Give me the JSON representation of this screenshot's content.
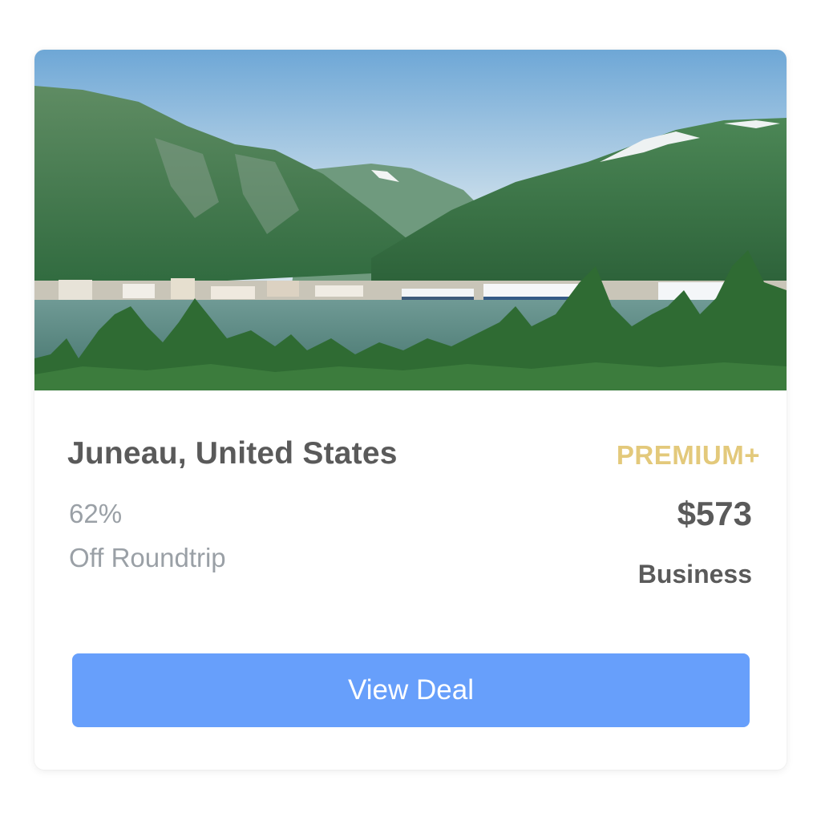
{
  "card": {
    "image_alt": "Juneau harbor with mountains, cruise ships and evergreen trees",
    "destination": "Juneau, United States",
    "tier": "PREMIUM+",
    "discount_percent": "62%",
    "discount_label": "Off Roundtrip",
    "price": "$573",
    "cabin_class": "Business",
    "cta_label": "View Deal"
  },
  "colors": {
    "tier": "#e3c97b",
    "button": "#679ffb",
    "title_text": "#5a5a5a",
    "muted_text": "#9aa0a6"
  }
}
